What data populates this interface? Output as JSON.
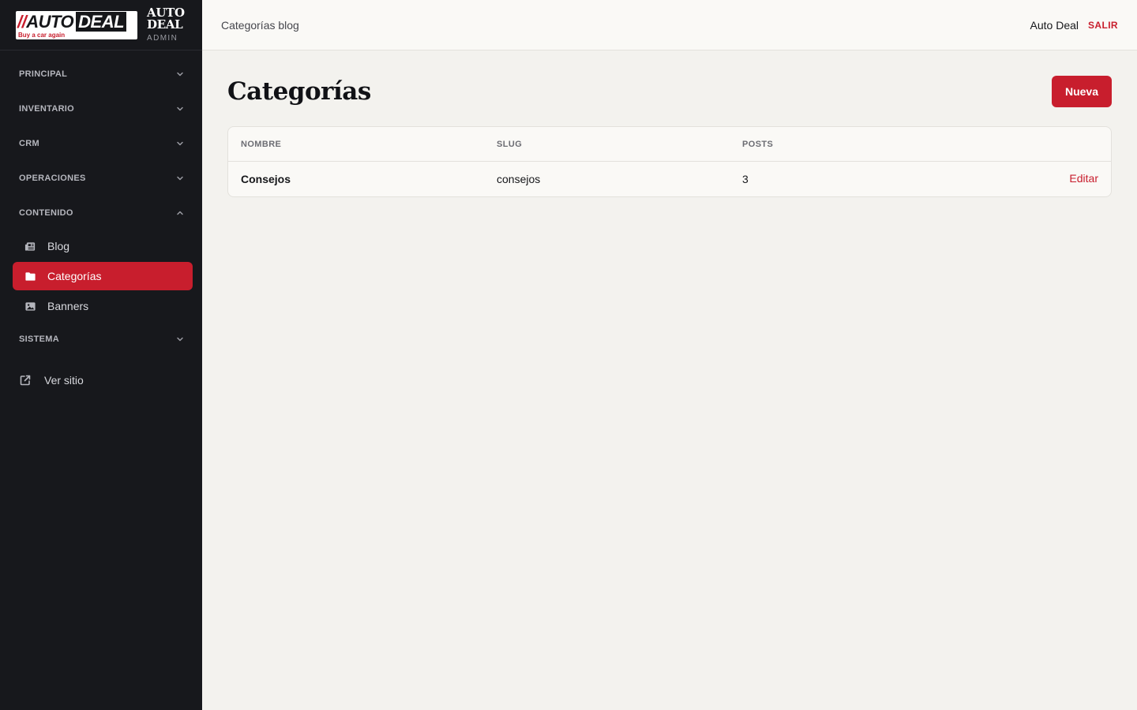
{
  "brand": {
    "logo_slashes": "//",
    "logo_auto": "AUTO",
    "logo_deal": "DEAL",
    "logo_tagline": "Buy a car again",
    "word_line1": "AUTO",
    "word_line2": "DEAL",
    "admin_label": "ADMIN"
  },
  "sidebar": {
    "sections": [
      {
        "label": "PRINCIPAL",
        "expanded": false
      },
      {
        "label": "INVENTARIO",
        "expanded": false
      },
      {
        "label": "CRM",
        "expanded": false
      },
      {
        "label": "OPERACIONES",
        "expanded": false
      },
      {
        "label": "CONTENIDO",
        "expanded": true
      },
      {
        "label": "SISTEMA",
        "expanded": false
      }
    ],
    "content_items": [
      {
        "label": "Blog",
        "icon": "newspaper-icon",
        "active": false
      },
      {
        "label": "Categorías",
        "icon": "folder-icon",
        "active": true
      },
      {
        "label": "Banners",
        "icon": "image-icon",
        "active": false
      }
    ],
    "view_site": {
      "label": "Ver sitio",
      "icon": "external-link-icon"
    }
  },
  "topbar": {
    "breadcrumb": "Categorías blog",
    "user_name": "Auto Deal",
    "logout_label": "SALIR"
  },
  "main": {
    "title": "Categorías",
    "new_button": "Nueva",
    "table": {
      "headers": [
        "NOMBRE",
        "SLUG",
        "POSTS"
      ],
      "rows": [
        {
          "name": "Consejos",
          "slug": "consejos",
          "posts": "3",
          "action": "Editar"
        }
      ]
    }
  },
  "colors": {
    "accent": "#c81e2d",
    "sidebar_bg": "#17181c",
    "page_bg": "#f3f2ee"
  }
}
